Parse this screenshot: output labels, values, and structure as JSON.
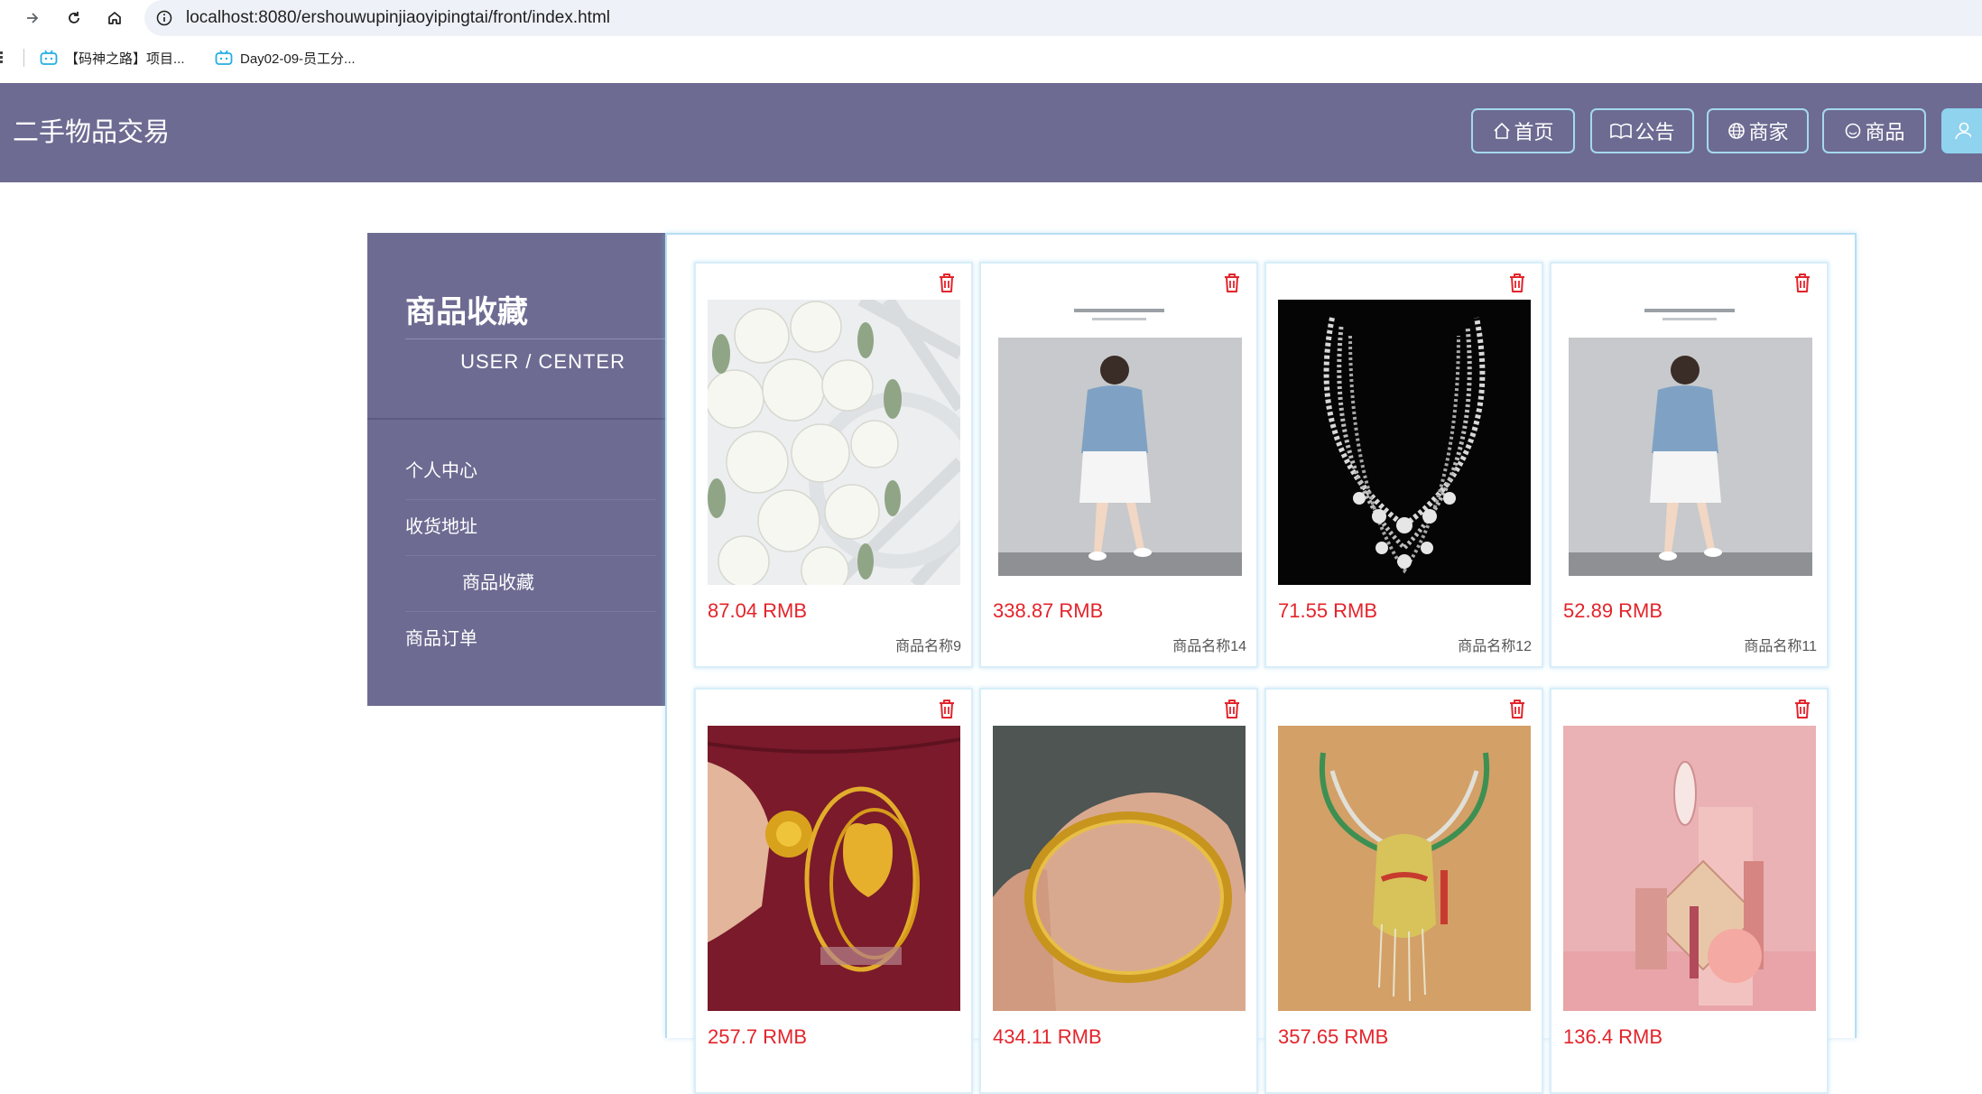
{
  "browser": {
    "url": "localhost:8080/ershouwupinjiaoyipingtai/front/index.html",
    "bookmarks": [
      {
        "label": "【码神之路】项目..."
      },
      {
        "label": "Day02-09-员工分..."
      }
    ]
  },
  "header": {
    "title": "二手物品交易",
    "nav": [
      {
        "label": "首页",
        "icon": "home-icon"
      },
      {
        "label": "公告",
        "icon": "book-icon"
      },
      {
        "label": "商家",
        "icon": "globe-icon"
      },
      {
        "label": "商品",
        "icon": "circle-icon"
      }
    ]
  },
  "sidebar": {
    "title": "商品收藏",
    "subtitle": "USER / CENTER",
    "items": [
      {
        "label": "个人中心"
      },
      {
        "label": "收货地址"
      },
      {
        "label": "商品收藏",
        "active": true
      },
      {
        "label": "商品订单"
      }
    ]
  },
  "products": [
    {
      "price": "87.04 RMB",
      "name": "商品名称9",
      "image": "white-flower-bouquet"
    },
    {
      "price": "338.87 RMB",
      "name": "商品名称14",
      "image": "woman-blue-top-white-skirt"
    },
    {
      "price": "71.55 RMB",
      "name": "商品名称12",
      "image": "diamond-necklace"
    },
    {
      "price": "52.89 RMB",
      "name": "商品名称11",
      "image": "woman-blue-top-white-skirt"
    },
    {
      "price": "257.7 RMB",
      "name": "",
      "image": "gold-earrings"
    },
    {
      "price": "434.11 RMB",
      "name": "",
      "image": "gold-bangle"
    },
    {
      "price": "357.65 RMB",
      "name": "",
      "image": "dragon-necklace"
    },
    {
      "price": "136.4 RMB",
      "name": "",
      "image": "cosmetics-set"
    }
  ],
  "colors": {
    "header_bg": "#6d6b92",
    "accent_border": "#a5d8ec",
    "price": "#e3242b"
  }
}
